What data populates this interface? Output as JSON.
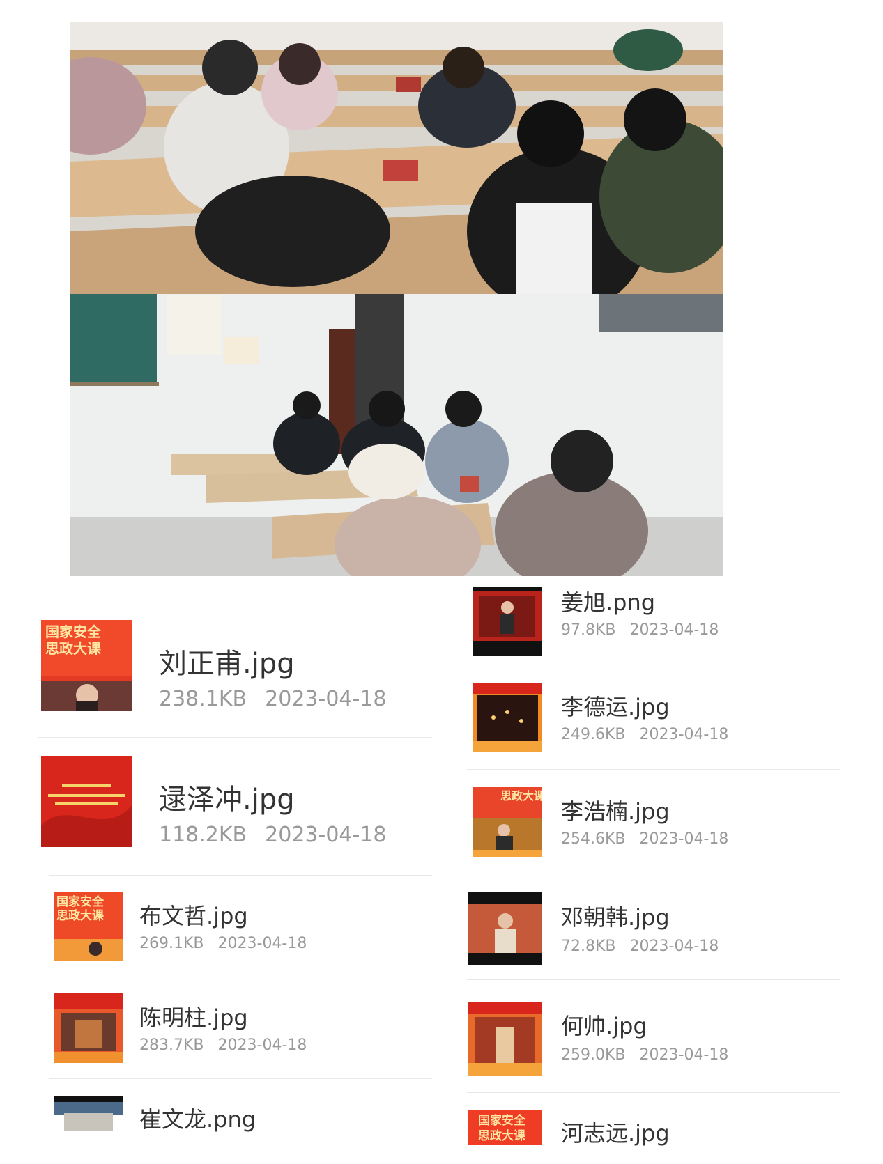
{
  "photos": [
    {
      "name": "students-watching-lecture-on-phones-classroom-1"
    },
    {
      "name": "students-watching-lecture-on-phones-classroom-2"
    }
  ],
  "thumb_banner": {
    "line1": "国家安全",
    "line2": "思政大课"
  },
  "left_files": [
    {
      "name": "刘正甫.jpg",
      "size": "238.1KB",
      "date": "2023-04-18"
    },
    {
      "name": "逯泽冲.jpg",
      "size": "118.2KB",
      "date": "2023-04-18"
    },
    {
      "name": "布文哲.jpg",
      "size": "269.1KB",
      "date": "2023-04-18"
    },
    {
      "name": "陈明柱.jpg",
      "size": "283.7KB",
      "date": "2023-04-18"
    },
    {
      "name": "崔文龙.png",
      "size": "",
      "date": ""
    }
  ],
  "right_files": [
    {
      "name": "姜旭.png",
      "size": "97.8KB",
      "date": "2023-04-18"
    },
    {
      "name": "李德运.jpg",
      "size": "249.6KB",
      "date": "2023-04-18"
    },
    {
      "name": "李浩楠.jpg",
      "size": "254.6KB",
      "date": "2023-04-18"
    },
    {
      "name": "邓朝韩.jpg",
      "size": "72.8KB",
      "date": "2023-04-18"
    },
    {
      "name": "何帅.jpg",
      "size": "259.0KB",
      "date": "2023-04-18"
    },
    {
      "name": "河志远.jpg",
      "size": "",
      "date": ""
    }
  ],
  "colors": {
    "red": "#d8261c",
    "orange": "#f08a24",
    "gold": "#f7d36b",
    "meta_gray": "#999999"
  }
}
